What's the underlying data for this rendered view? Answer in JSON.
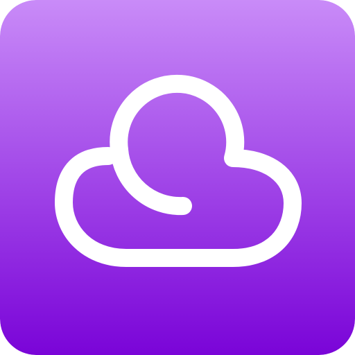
{
  "icon": {
    "name": "cloud-icon",
    "gradient_top": "#C98BF8",
    "gradient_bottom": "#7A04D8",
    "stroke_color": "#FFFFFF"
  }
}
